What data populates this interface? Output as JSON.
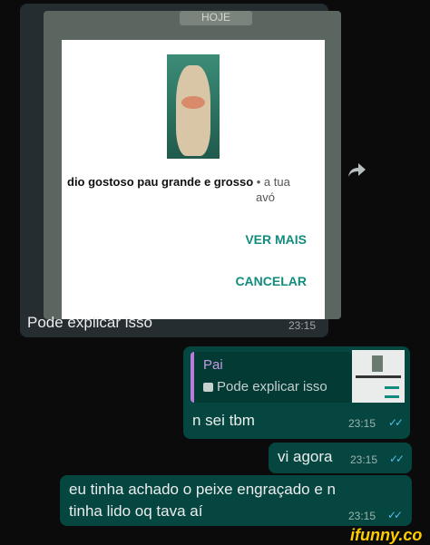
{
  "incoming": {
    "screenshot": {
      "date_chip": "HOJE",
      "caption": "dio gostoso pau grande e grosso",
      "caption_meta": " • a tua",
      "caption_meta2": "avó",
      "buttons": [
        "VER MAIS",
        "CANCELAR"
      ]
    },
    "text": "Pode explicar isso",
    "time": "23:15"
  },
  "forward_icon": "forward-arrow-icon",
  "outgoing": [
    {
      "quote": {
        "name": "Pai",
        "text": "Pode explicar isso",
        "icon": "image-icon"
      },
      "text": "n sei tbm",
      "time": "23:15",
      "ticks": "✓✓"
    },
    {
      "text": "vi agora",
      "time": "23:15",
      "ticks": "✓✓"
    },
    {
      "lines": [
        "eu tinha achado o peixe engraçado e n",
        "tinha lido oq tava aí"
      ],
      "time": "23:15",
      "ticks": "✓✓"
    }
  ],
  "watermark": "ifunny.co",
  "colors": {
    "incoming_bg": "#262d31",
    "outgoing_bg": "#054740",
    "accent": "#128c7e",
    "read_ticks": "#53bdeb"
  }
}
